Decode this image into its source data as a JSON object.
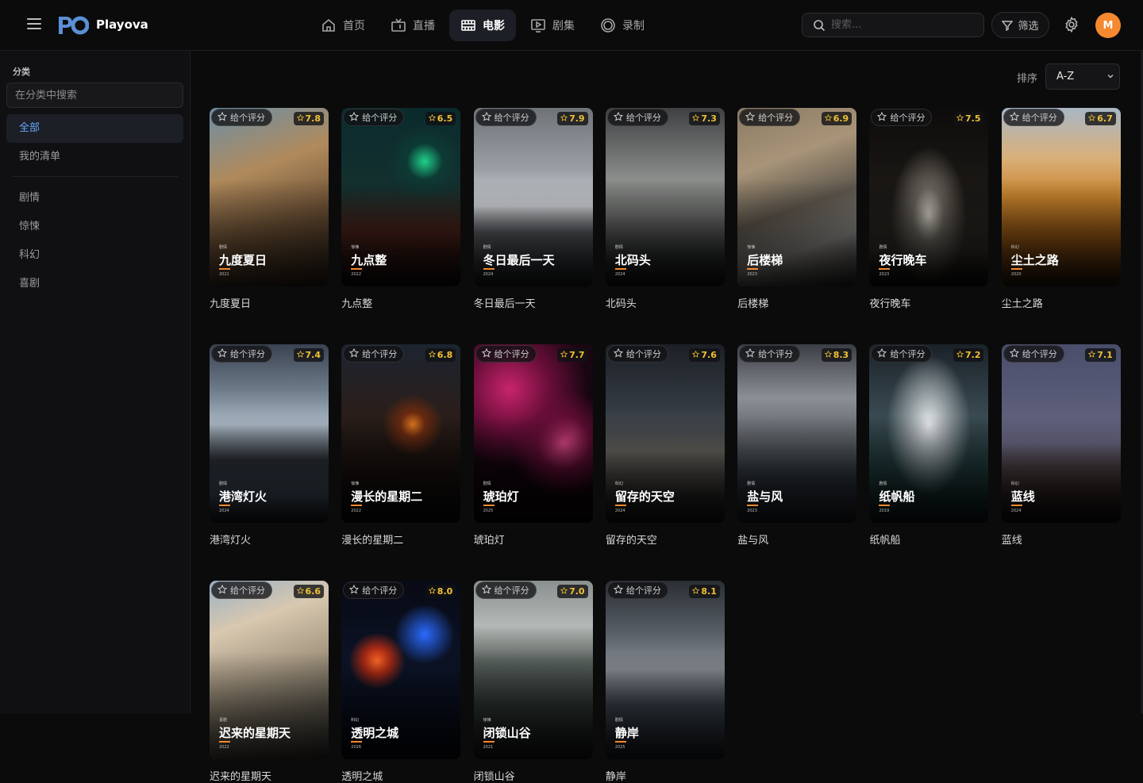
{
  "header": {
    "app_name": "Playova",
    "nav": [
      {
        "label": "首页",
        "icon": "home-icon",
        "active": false
      },
      {
        "label": "直播",
        "icon": "tv-icon",
        "active": false
      },
      {
        "label": "电影",
        "icon": "film-icon",
        "active": true
      },
      {
        "label": "剧集",
        "icon": "play-screen-icon",
        "active": false
      },
      {
        "label": "录制",
        "icon": "record-icon",
        "active": false
      }
    ],
    "search_placeholder": "搜索...",
    "filter_label": "筛选",
    "avatar_initial": "M"
  },
  "sidebar": {
    "title": "分类",
    "search_placeholder": "在分类中搜索",
    "items": [
      {
        "label": "全部",
        "active": true
      },
      {
        "label": "我的清单",
        "active": false
      }
    ],
    "genres": [
      "剧情",
      "惊悚",
      "科幻",
      "喜剧"
    ]
  },
  "main": {
    "sort_label": "排序",
    "sort_value": "A-Z",
    "rate_label": "给个评分"
  },
  "colors": {
    "accent": "#64a8ff",
    "brand_orange": "#f5892f",
    "score_yellow": "#f1c232",
    "background": "#0b0b0c"
  },
  "movies": [
    {
      "title": "九度夏日",
      "score": "7.8",
      "genre": "剧情",
      "year": "2021",
      "bg": "linear-gradient(160deg,#6d8fa6 0%,#b08a5c 35%,#6e5236 65%,#2a2018 100%)"
    },
    {
      "title": "九点整",
      "score": "6.5",
      "genre": "惊悚",
      "year": "2022",
      "bg": "radial-gradient(circle at 70% 30%,#1fd18a 0,#0d3a34 12%,rgba(0,0,0,0) 25%),linear-gradient(180deg,#0a2a2c 0%,#14302f 45%,#4a2018 70%,#0b0b0b 100%)"
    },
    {
      "title": "冬日最后一天",
      "score": "7.9",
      "genre": "剧情",
      "year": "2024",
      "bg": "linear-gradient(180deg,#6f7378 0%,#9aa0a6 35%,#d6d9dc 55%,#55595e 70%,#1b1d20 100%)"
    },
    {
      "title": "北码头",
      "score": "7.3",
      "genre": "剧情",
      "year": "2024",
      "bg": "linear-gradient(180deg,#3e4042 0%,#8c8e8c 40%,#6f716f 60%,#2a2c2c 85%,#141515 100%)"
    },
    {
      "title": "后楼梯",
      "score": "6.9",
      "genre": "惊悚",
      "year": "2023",
      "bg": "linear-gradient(160deg,#8a7a64 0%,#a89478 30%,#5f584e 55%,#8c8a86 75%,#2a2826 100%)"
    },
    {
      "title": "夜行晚车",
      "score": "7.5",
      "genre": "剧情",
      "year": "2023",
      "bg": "radial-gradient(ellipse at 50% 60%,#d9d6cc 0,#6a655d 18%,rgba(0,0,0,0) 45%),linear-gradient(180deg,#0e0c0b 0%,#1c1916 50%,#2e2a25 80%,#0e0d0c 100%)"
    },
    {
      "title": "尘土之路",
      "score": "6.7",
      "genre": "科幻",
      "year": "2020",
      "bg": "linear-gradient(180deg,#a8b6c4 0%,#d9b07a 28%,#c8842c 50%,#8a4e12 75%,#2a1a0a 100%)"
    },
    {
      "title": "港湾灯火",
      "score": "7.4",
      "genre": "剧情",
      "year": "2024",
      "bg": "linear-gradient(180deg,#3a4250 0%,#6c7a88 25%,#aab8c4 45%,#2a2e34 65%,#3c4a58 85%,#1a1e24 100%)"
    },
    {
      "title": "漫长的星期二",
      "score": "6.8",
      "genre": "惊悚",
      "year": "2022",
      "bg": "radial-gradient(circle at 60% 45%,#e0781f 0,#6a2a10 10%,rgba(0,0,0,0) 25%),linear-gradient(180deg,#1c2430 0%,#2a1e1a 40%,#160f0c 70%,#0a0a0a 100%)"
    },
    {
      "title": "琥珀灯",
      "score": "7.7",
      "genre": "剧情",
      "year": "2025",
      "bg": "radial-gradient(circle at 30% 25%,#c8246a 0,#6a0e3a 25%,rgba(0,0,0,0) 50%),radial-gradient(circle at 75% 55%,#e04a8a 0,#5a0c30 20%,rgba(0,0,0,0) 40%),linear-gradient(180deg,#1a0612 0%,#0c0408 100%)"
    },
    {
      "title": "留存的天空",
      "score": "7.6",
      "genre": "科幻",
      "year": "2024",
      "bg": "linear-gradient(180deg,#1c2026 0%,#343a42 35%,#4a4e52 50%,#6a6862 60%,#2a2826 85%,#141414 100%)"
    },
    {
      "title": "盐与风",
      "score": "8.3",
      "genre": "剧情",
      "year": "2023",
      "bg": "linear-gradient(180deg,#3a3e44 0%,#8c9096 30%,#5a5e64 55%,#2a3038 75%,#1a2028 100%)"
    },
    {
      "title": "纸帆船",
      "score": "7.2",
      "genre": "剧情",
      "year": "2019",
      "bg": "radial-gradient(ellipse at 50% 45%,#e8ebec 0,#8a9498 25%,rgba(0,0,0,0) 50%),linear-gradient(180deg,#1a2228 0%,#3a4a52 40%,#1e3838 70%,#0e1a1c 100%)"
    },
    {
      "title": "蓝线",
      "score": "7.1",
      "genre": "科幻",
      "year": "2024",
      "bg": "linear-gradient(180deg,#4a4e6a 0%,#5a5c78 35%,#6a6884 55%,#4a3e3e 70%,#2a2020 85%,#121010 100%)"
    },
    {
      "title": "迟来的星期天",
      "score": "6.6",
      "genre": "喜剧",
      "year": "2022",
      "bg": "linear-gradient(160deg,#9ab0c4 0%,#d8c8b0 25%,#a89a84 50%,#6a6458 75%,#3a3632 100%)"
    },
    {
      "title": "透明之城",
      "score": "8.0",
      "genre": "科幻",
      "year": "2026",
      "bg": "radial-gradient(circle at 30% 45%,#ff6a2a 0,#a82a14 10%,rgba(0,0,0,0) 22%),radial-gradient(circle at 70% 30%,#2a6aff 0,rgba(0,0,0,0) 20%),linear-gradient(180deg,#080a14 0%,#0c1428 50%,#060810 100%)"
    },
    {
      "title": "闭锁山谷",
      "score": "7.0",
      "genre": "惊悚",
      "year": "2021",
      "bg": "linear-gradient(180deg,#8a9090 0%,#b4b8b6 25%,#5a625e 45%,#2e3632 70%,#141816 100%)"
    },
    {
      "title": "静岸",
      "score": "8.1",
      "genre": "剧情",
      "year": "2025",
      "bg": "linear-gradient(180deg,#2a2e34 0%,#5a6068 30%,#8a9096 50%,#3e4650 70%,#1a2028 100%)"
    }
  ]
}
